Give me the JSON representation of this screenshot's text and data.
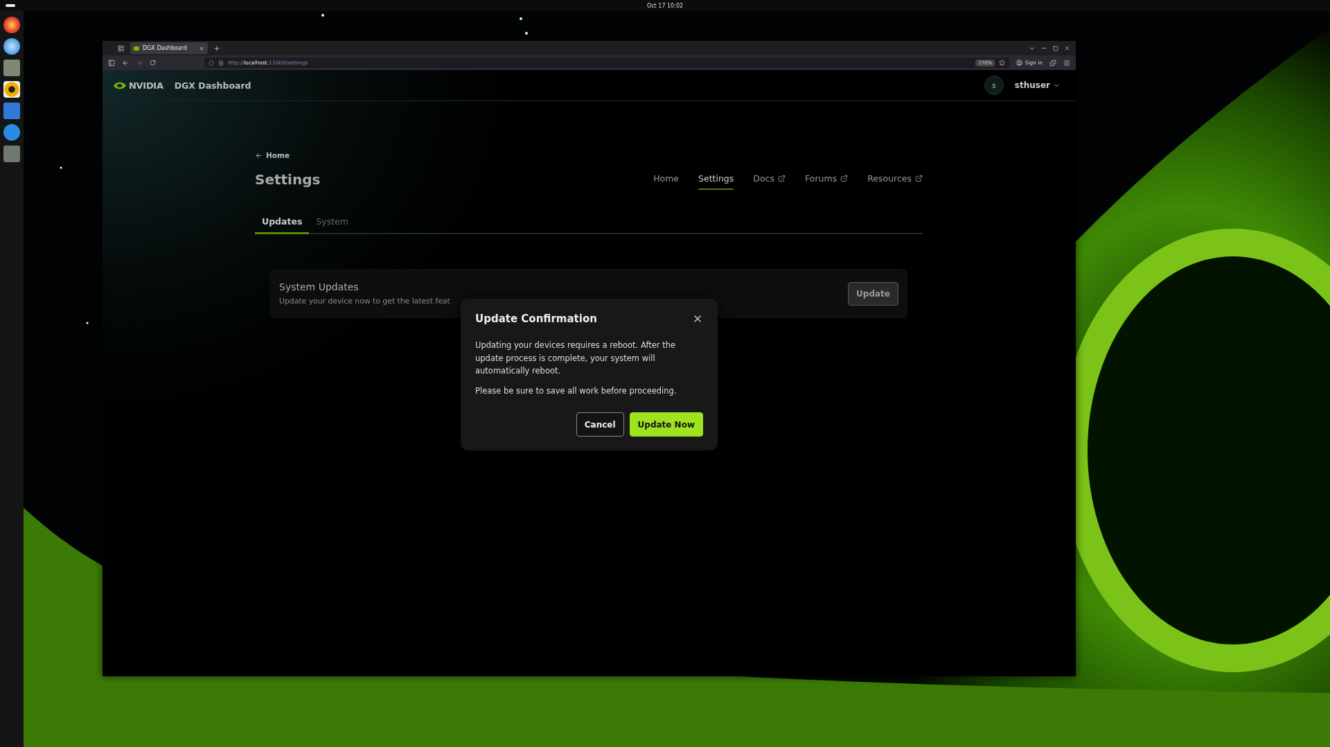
{
  "top_bar": {
    "clock": "Oct 17  10:02"
  },
  "browser": {
    "tabs": [
      {
        "title": "DGX Dashboard",
        "selected": true
      }
    ],
    "url": "http://**localhost**:11000/settings",
    "zoom": "170%",
    "sign_in": "Sign in"
  },
  "app": {
    "brand": "NVIDIA",
    "product": "DGX Dashboard",
    "user": {
      "initial": "s",
      "name": "sthuser"
    }
  },
  "back_link": "Home",
  "page_title": "Settings",
  "nav": [
    {
      "label": "Home",
      "selected": false,
      "external": false
    },
    {
      "label": "Settings",
      "selected": true,
      "external": false
    },
    {
      "label": "Docs",
      "selected": false,
      "external": true
    },
    {
      "label": "Forums",
      "selected": false,
      "external": true
    },
    {
      "label": "Resources",
      "selected": false,
      "external": true
    }
  ],
  "tabs": [
    {
      "label": "Updates",
      "selected": true
    },
    {
      "label": "System",
      "selected": false
    }
  ],
  "card": {
    "title": "System Updates",
    "description": "Update your device now to get the latest feat",
    "button": "Update"
  },
  "dialog": {
    "title": "Update Confirmation",
    "paragraphs": [
      "Updating your devices requires a reboot. After the update process is complete, your system will automatically reboot.",
      "Please be sure to save all work before proceeding."
    ],
    "buttons": [
      {
        "label": "Cancel",
        "kind": "secondary"
      },
      {
        "label": "Update Now",
        "kind": "primary"
      }
    ]
  }
}
